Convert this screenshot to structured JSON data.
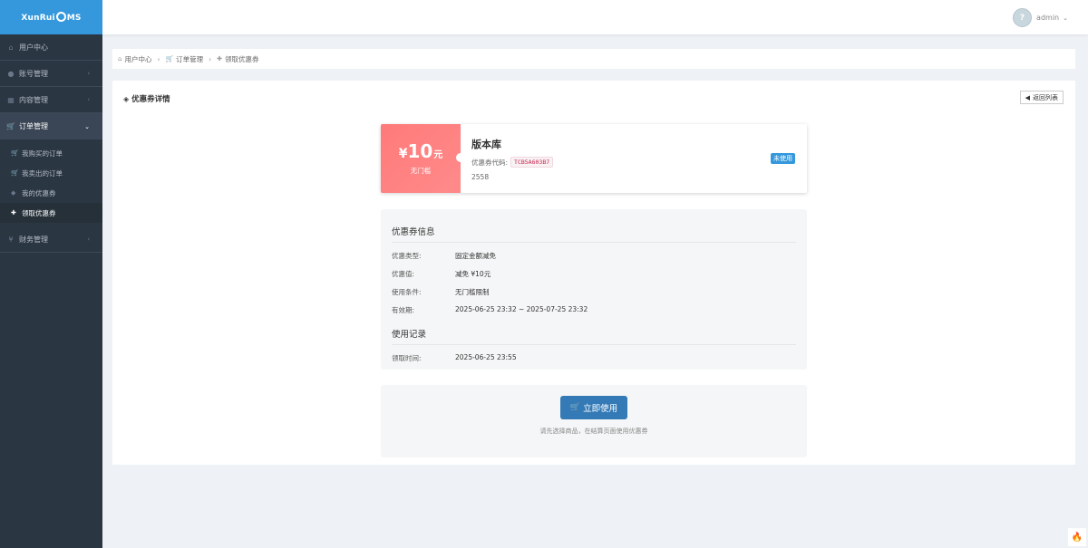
{
  "app": {
    "logo_text": "XunRuiCMS",
    "logo_pre": "XunRui",
    "logo_post": "MS"
  },
  "header": {
    "username": "admin"
  },
  "sidebar": {
    "items": [
      {
        "label": "用户中心",
        "icon": "home-icon"
      },
      {
        "label": "账号管理",
        "icon": "user-icon"
      },
      {
        "label": "内容管理",
        "icon": "grid-icon"
      },
      {
        "label": "订单管理",
        "icon": "cart-icon"
      },
      {
        "label": "财务管理",
        "icon": "yen-icon"
      }
    ],
    "sub_items": [
      {
        "label": "我购买的订单",
        "icon": "cart-icon"
      },
      {
        "label": "我卖出的订单",
        "icon": "cart-icon"
      },
      {
        "label": "我的优惠券",
        "icon": "tag-icon"
      },
      {
        "label": "领取优惠券",
        "icon": "plus-icon"
      }
    ]
  },
  "breadcrumb": {
    "items": [
      "用户中心",
      "订单管理",
      "领取优惠券"
    ]
  },
  "card": {
    "title": "优惠券详情",
    "back_label": "返回列表"
  },
  "coupon": {
    "currency": "¥",
    "amount": "10",
    "unit": "元",
    "condition": "无门槛",
    "name": "版本库",
    "code_label": "优惠券代码:",
    "code": "TCB5A603B7",
    "id": "2558",
    "status": "未使用"
  },
  "info": {
    "section1_title": "优惠券信息",
    "rows": [
      {
        "key": "优惠类型:",
        "value": "固定金额减免"
      },
      {
        "key": "优惠值:",
        "value": "减免 ¥10元"
      },
      {
        "key": "使用条件:",
        "value": "无门槛限制"
      },
      {
        "key": "有效期:",
        "value": "2025-06-25 23:32 ~ 2025-07-25 23:32"
      }
    ],
    "section2_title": "使用记录",
    "records": [
      {
        "key": "领取时间:",
        "value": "2025-06-25 23:55"
      }
    ]
  },
  "action": {
    "button_label": "立即使用",
    "hint": "请先选择商品，在结算页面使用优惠券"
  },
  "colors": {
    "sidebar_bg": "#2b3643",
    "logo_bg": "#3598dc",
    "coupon_red": "#ff7a7a",
    "primary": "#337ab7",
    "status_blue": "#3598dc"
  }
}
